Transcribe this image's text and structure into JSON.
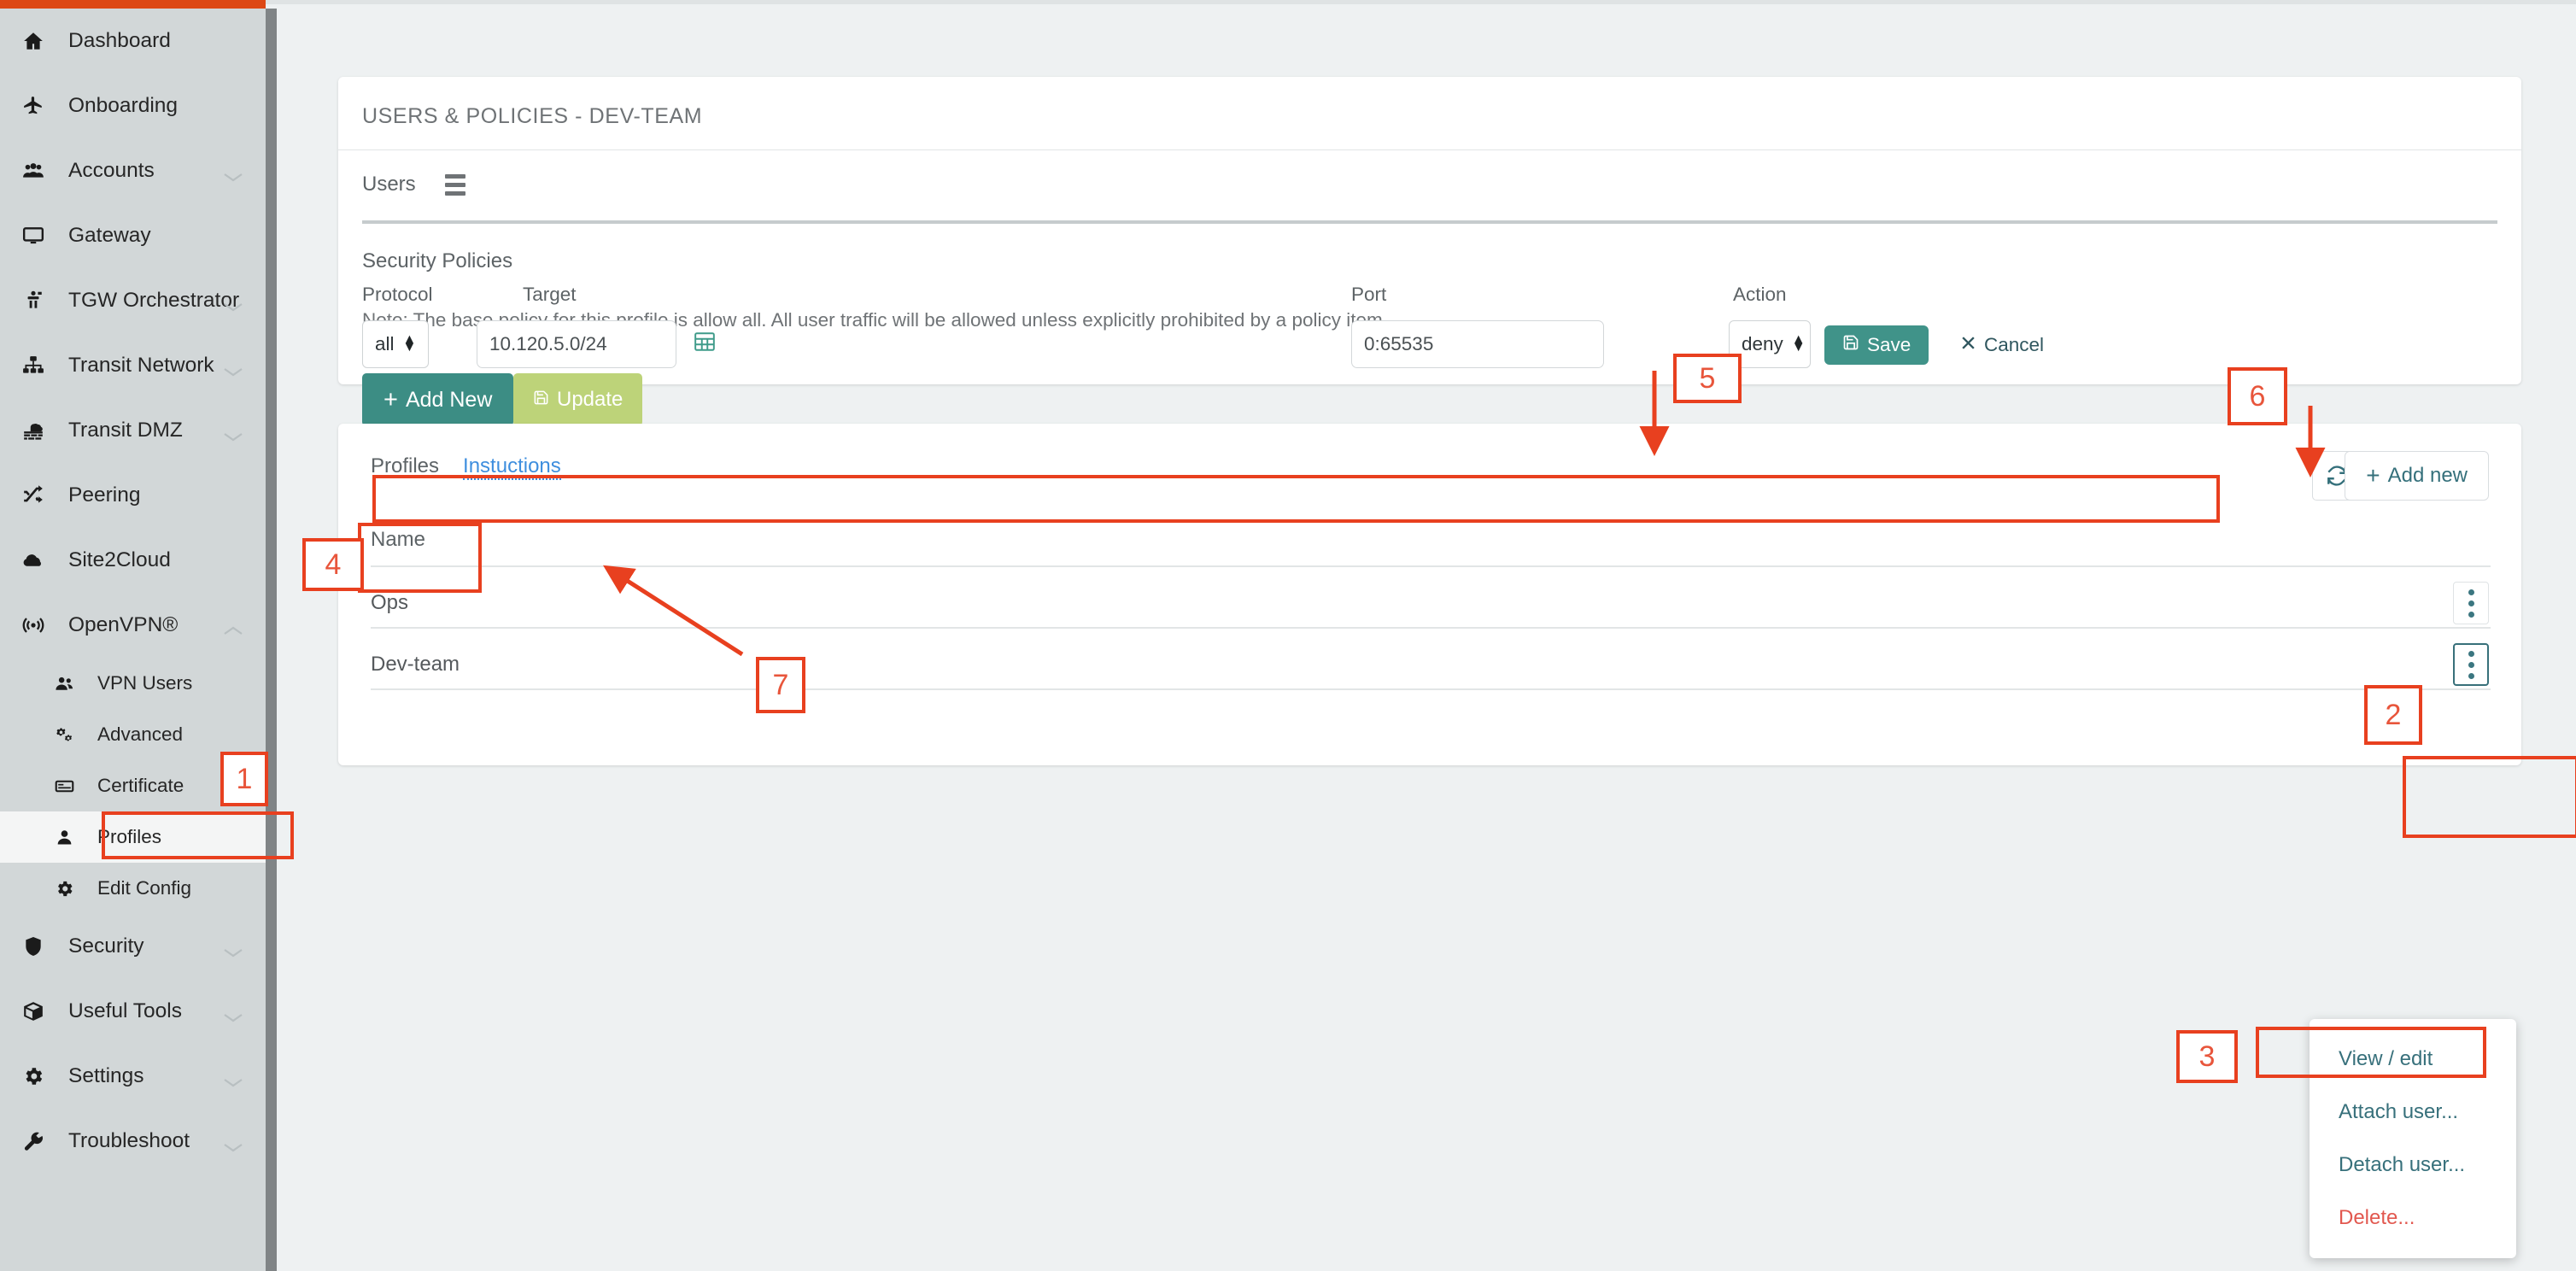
{
  "sidebar": {
    "items": [
      {
        "label": "Dashboard",
        "icon": "home-icon",
        "caret": false,
        "sub": false,
        "active": false
      },
      {
        "label": "Onboarding",
        "icon": "plane-icon",
        "caret": false,
        "sub": false,
        "active": false
      },
      {
        "label": "Accounts",
        "icon": "users-group-icon",
        "caret": true,
        "sub": false,
        "active": false
      },
      {
        "label": "Gateway",
        "icon": "monitor-icon",
        "caret": false,
        "sub": false,
        "active": false
      },
      {
        "label": "TGW Orchestrator",
        "icon": "orchestrator-icon",
        "caret": true,
        "sub": false,
        "active": false
      },
      {
        "label": "Transit Network",
        "icon": "sitemap-icon",
        "caret": true,
        "sub": false,
        "active": false
      },
      {
        "label": "Transit DMZ",
        "icon": "firewall-icon",
        "caret": true,
        "sub": false,
        "active": false
      },
      {
        "label": "Peering",
        "icon": "shuffle-icon",
        "caret": false,
        "sub": false,
        "active": false
      },
      {
        "label": "Site2Cloud",
        "icon": "cloud-upload-icon",
        "caret": false,
        "sub": false,
        "active": false
      },
      {
        "label": "OpenVPN®",
        "icon": "broadcast-icon",
        "caret": true,
        "caretUp": true,
        "sub": false,
        "active": false
      },
      {
        "label": "VPN Users",
        "icon": "user-friends-icon",
        "caret": false,
        "sub": true,
        "active": false
      },
      {
        "label": "Advanced",
        "icon": "cogs-icon",
        "caret": false,
        "sub": true,
        "active": false
      },
      {
        "label": "Certificate",
        "icon": "id-card-icon",
        "caret": false,
        "sub": true,
        "active": false
      },
      {
        "label": "Profiles",
        "icon": "user-icon",
        "caret": false,
        "sub": true,
        "active": true
      },
      {
        "label": "Edit Config",
        "icon": "gear-icon",
        "caret": false,
        "sub": true,
        "active": false
      },
      {
        "label": "Security",
        "icon": "shield-icon",
        "caret": true,
        "sub": false,
        "active": false
      },
      {
        "label": "Useful Tools",
        "icon": "box-icon",
        "caret": true,
        "sub": false,
        "active": false
      },
      {
        "label": "Settings",
        "icon": "gear-icon",
        "caret": true,
        "sub": false,
        "active": false
      },
      {
        "label": "Troubleshoot",
        "icon": "wrench-icon",
        "caret": true,
        "sub": false,
        "active": false
      }
    ]
  },
  "policies_card": {
    "title": "USERS & POLICIES - DEV-TEAM",
    "users_label": "Users",
    "users_menu_icon": "hamburger-icon",
    "section_title": "Security Policies",
    "note": "Note: The base policy for this profile is allow all. All user traffic will be allowed unless explicitly prohibited by a policy item",
    "columns": {
      "protocol": "Protocol",
      "target": "Target",
      "port": "Port",
      "action": "Action"
    },
    "row": {
      "protocol_value": "all",
      "target_value": "10.120.5.0/24",
      "target_picker_icon": "table-grid-icon",
      "port_value": "0:65535",
      "action_value": "deny",
      "save_label": "Save",
      "save_icon": "floppy-disk-icon",
      "cancel_label": "Cancel",
      "cancel_icon": "close-x-icon"
    },
    "add_new_label": "Add New",
    "add_new_icon": "plus-icon",
    "update_label": "Update",
    "update_icon": "floppy-disk-icon",
    "cancel_label": "Cancel",
    "cancel_icon": "close-x-icon"
  },
  "profiles_card": {
    "tab_profiles": "Profiles",
    "tab_instructions": "Instuctions",
    "refresh_icon": "refresh-icon",
    "add_new_label": "Add new",
    "add_new_icon": "plus-icon",
    "columns": [
      "Name"
    ],
    "rows": [
      {
        "name": "Ops",
        "menu_icon": "kebab-menu-icon",
        "menu_active": false
      },
      {
        "name": "Dev-team",
        "menu_icon": "kebab-menu-icon",
        "menu_active": true
      }
    ]
  },
  "context_menu": {
    "items": [
      {
        "label": "View / edit",
        "danger": false
      },
      {
        "label": "Attach user...",
        "danger": false
      },
      {
        "label": "Detach user...",
        "danger": false
      },
      {
        "label": "Delete...",
        "danger": true
      }
    ]
  },
  "annotations": {
    "n1": "1",
    "n2": "2",
    "n3": "3",
    "n4": "4",
    "n5": "5",
    "n6": "6",
    "n7": "7"
  },
  "colors": {
    "accent_orange": "#dd4814",
    "annotation_red": "#e8401f",
    "teal": "#3c8d84",
    "link_blue": "#3e8ede",
    "danger_red": "#da5f5c",
    "update_green": "#bdd379"
  }
}
